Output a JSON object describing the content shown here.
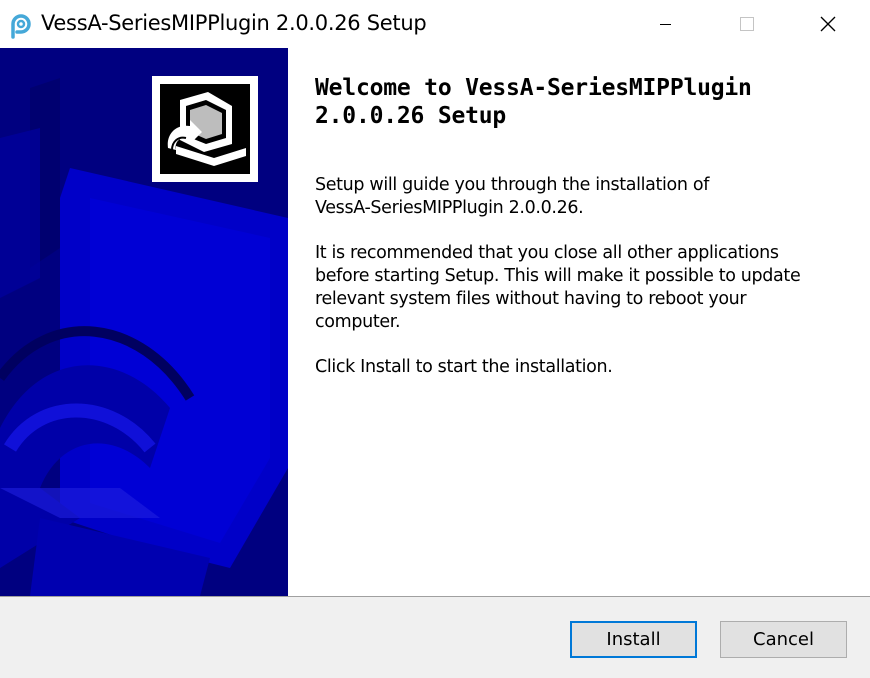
{
  "window": {
    "title": "VessA-SeriesMIPPlugin 2.0.0.26 Setup"
  },
  "content": {
    "heading": "Welcome to VessA-SeriesMIPPlugin\n2.0.0.26 Setup",
    "paragraph1": "Setup will guide you through the installation of\nVessA-SeriesMIPPlugin 2.0.0.26.",
    "paragraph2": "It is recommended that you close all other applications\nbefore starting Setup. This will make it possible to update\nrelevant system files without having to reboot your\ncomputer.",
    "paragraph3": "Click Install to start the installation."
  },
  "buttons": {
    "install": "Install",
    "cancel": "Cancel"
  },
  "icons": {
    "app": "p-logo-icon",
    "installer": "computer-install-icon"
  },
  "colors": {
    "banner_bg": "#000080",
    "banner_shape": "#0000c8",
    "focus_border": "#0078d7",
    "footer_bg": "#f0f0f0"
  }
}
